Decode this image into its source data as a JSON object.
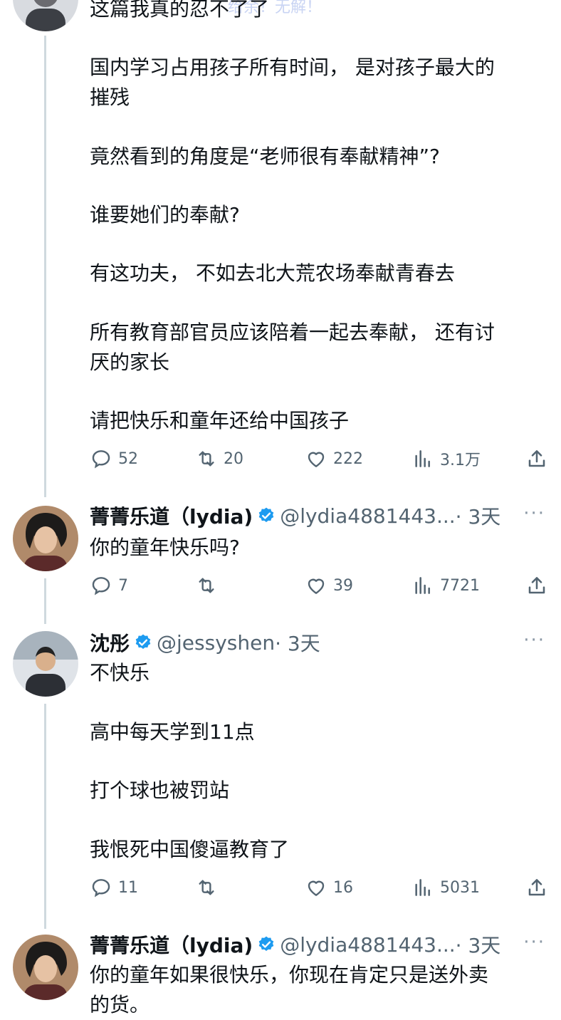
{
  "watermark": "给余！无解！",
  "post1": {
    "lines": [
      "这篇我真的忍不了了",
      "国内学习占用孩子所有时间， 是对孩子最大的",
      "摧残",
      "竟然看到的角度是“老师很有奉献精神”?",
      "谁要她们的奉献?",
      "有这功夫， 不如去北大荒农场奉献青春去",
      "所有教育部官员应该陪着一起去奉献， 还有讨",
      "厌的家长",
      "请把快乐和童年还给中国孩子"
    ],
    "stats": {
      "replies": "52",
      "retweets": "20",
      "likes": "222",
      "views": "3.1万"
    }
  },
  "reply1": {
    "name": "菁菁乐道（lydia)",
    "handle": "@lydia4881443...",
    "time": "· 3天",
    "more": "···",
    "lines": [
      "你的童年快乐吗?"
    ],
    "stats": {
      "replies": "7",
      "retweets": "",
      "likes": "39",
      "views": "7721"
    }
  },
  "reply2": {
    "name": "沈彤",
    "handle": "@jessyshen",
    "time": "· 3天",
    "more": "···",
    "lines": [
      "不快乐",
      "高中每天学到11点",
      "打个球也被罚站",
      "我恨死中国傻逼教育了"
    ],
    "stats": {
      "replies": "11",
      "retweets": "",
      "likes": "16",
      "views": "5031"
    }
  },
  "reply3": {
    "name": "菁菁乐道（lydia)",
    "handle": "@lydia4881443...",
    "time": "· 3天",
    "more": "···",
    "lines": [
      "你的童年如果很快乐，你现在肯定只是送外卖",
      "的货。"
    ]
  },
  "icons": {
    "reply": "reply-icon",
    "retweet": "retweet-icon",
    "like": "heart-icon",
    "views": "views-icon",
    "share": "share-icon",
    "verified": "verified-badge-icon"
  },
  "colors": {
    "verified": "#1d9bf0",
    "handle": "#536471",
    "thread_line": "#cfd9de"
  }
}
